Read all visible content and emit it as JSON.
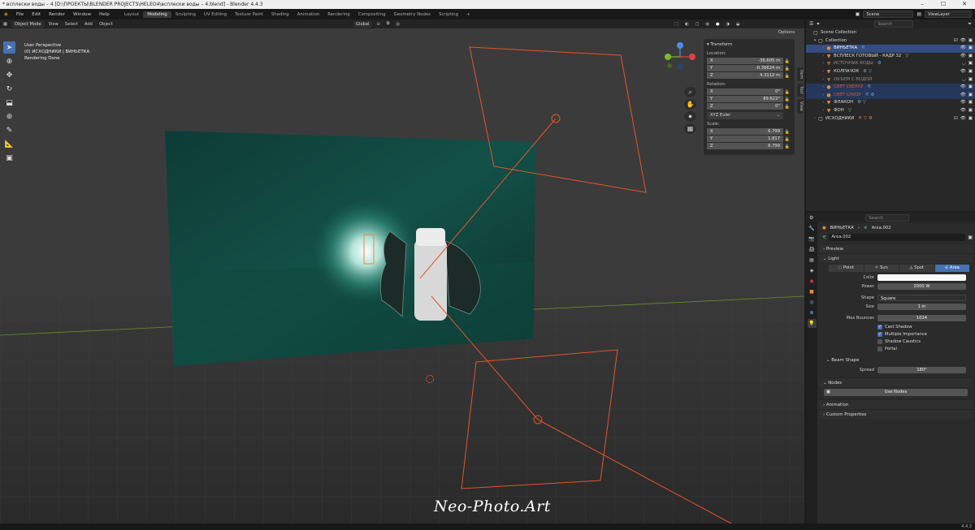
{
  "window": {
    "title": "* всплески воды – 4 [D:\\ПРОЕКТЫ\\BLENDER PROJECTS\\HELEO4\\всплески воды – 4.blend] - Blender 4.4.3",
    "minimize_icon": "minimize-icon",
    "maximize_icon": "maximize-icon",
    "close_icon": "close-icon"
  },
  "menu": [
    "File",
    "Edit",
    "Render",
    "Window",
    "Help"
  ],
  "workspaces": [
    "Layout",
    "Modeling",
    "Sculpting",
    "UV Editing",
    "Texture Paint",
    "Shading",
    "Animation",
    "Rendering",
    "Compositing",
    "Geometry Nodes",
    "Scripting",
    "+"
  ],
  "active_workspace": "Modeling",
  "scene": {
    "name": "Scene",
    "view_layer": "ViewLayer"
  },
  "viewport_header": {
    "mode": "Object Mode",
    "menus": [
      "View",
      "Select",
      "Add",
      "Object"
    ],
    "orientation": "Global",
    "options": "Options"
  },
  "viewport": {
    "line1": "User Perspective",
    "line2": "(0) ИСХОДНИКИ | ВИНЬЕТКА",
    "line3": "Rendering Done",
    "gizmo": {
      "x": "X",
      "y": "Y",
      "z": "Z"
    },
    "watermark": "Neo-Photo.Art"
  },
  "npanel": {
    "header": "Transform",
    "location_label": "Location:",
    "location": [
      {
        "axis": "X",
        "value": "-36.605 m"
      },
      {
        "axis": "Y",
        "value": "-0.36624 m"
      },
      {
        "axis": "Z",
        "value": "4.3112 m"
      }
    ],
    "rotation_label": "Rotation:",
    "rotation": [
      {
        "axis": "X",
        "value": "0°"
      },
      {
        "axis": "Y",
        "value": "89.622°"
      },
      {
        "axis": "Z",
        "value": "0°"
      }
    ],
    "rotation_mode": "XYZ Euler",
    "scale_label": "Scale:",
    "scale": [
      {
        "axis": "X",
        "value": "6.799"
      },
      {
        "axis": "Y",
        "value": "1.817"
      },
      {
        "axis": "Z",
        "value": "6.799"
      }
    ],
    "tabs": [
      "Item",
      "Tool",
      "View"
    ]
  },
  "outliner": {
    "search_placeholder": "Search",
    "items": [
      {
        "label": "Scene Collection"
      },
      {
        "label": "Collection"
      },
      {
        "label": "ВИНЬЕТКА"
      },
      {
        "label": "ВСПЛЕСК ГОТОВЫЙ - КАДР 32"
      },
      {
        "label": "ИСТОЧНИК ВОДЫ"
      },
      {
        "label": "КОЛПАЧОК"
      },
      {
        "label": "ОБЪЕМ С ВОДОЙ"
      },
      {
        "label": "СВЕТ СВЕРХУ"
      },
      {
        "label": "СВЕТ СНИЗУ"
      },
      {
        "label": "ФЛАКОН"
      },
      {
        "label": "ФОН"
      },
      {
        "label": "ИСХОДНИКИ"
      }
    ]
  },
  "properties": {
    "search_placeholder": "Search",
    "breadcrumb": [
      "ВИНЬЕТКА",
      "Area.002"
    ],
    "datablock": "Area.002",
    "sections": {
      "preview": "Preview",
      "light": "Light",
      "beam_shape": "Beam Shape",
      "nodes": "Nodes",
      "animation": "Animation",
      "custom_properties": "Custom Properties"
    },
    "light_types": [
      "Point",
      "Sun",
      "Spot",
      "Area"
    ],
    "active_light_type": "Area",
    "color_label": "Color",
    "color_value": "#fafafa",
    "power_label": "Power",
    "power": "2000 W",
    "shape_label": "Shape",
    "shape": "Square",
    "size_label": "Size",
    "size": "1 m",
    "max_bounces_label": "Max Bounces",
    "max_bounces": "1024",
    "checkboxes": [
      {
        "label": "Cast Shadow",
        "checked": true
      },
      {
        "label": "Multiple Importance",
        "checked": true
      },
      {
        "label": "Shadow Caustics",
        "checked": false
      },
      {
        "label": "Portal",
        "checked": false
      }
    ],
    "spread_label": "Spread",
    "spread": "180°",
    "use_nodes": "Use Nodes"
  },
  "status": {
    "version": "4.4.3"
  },
  "colors": {
    "accent": "#4772b3",
    "light_orange": "#e2552a",
    "object_orange": "#e38b3a"
  }
}
